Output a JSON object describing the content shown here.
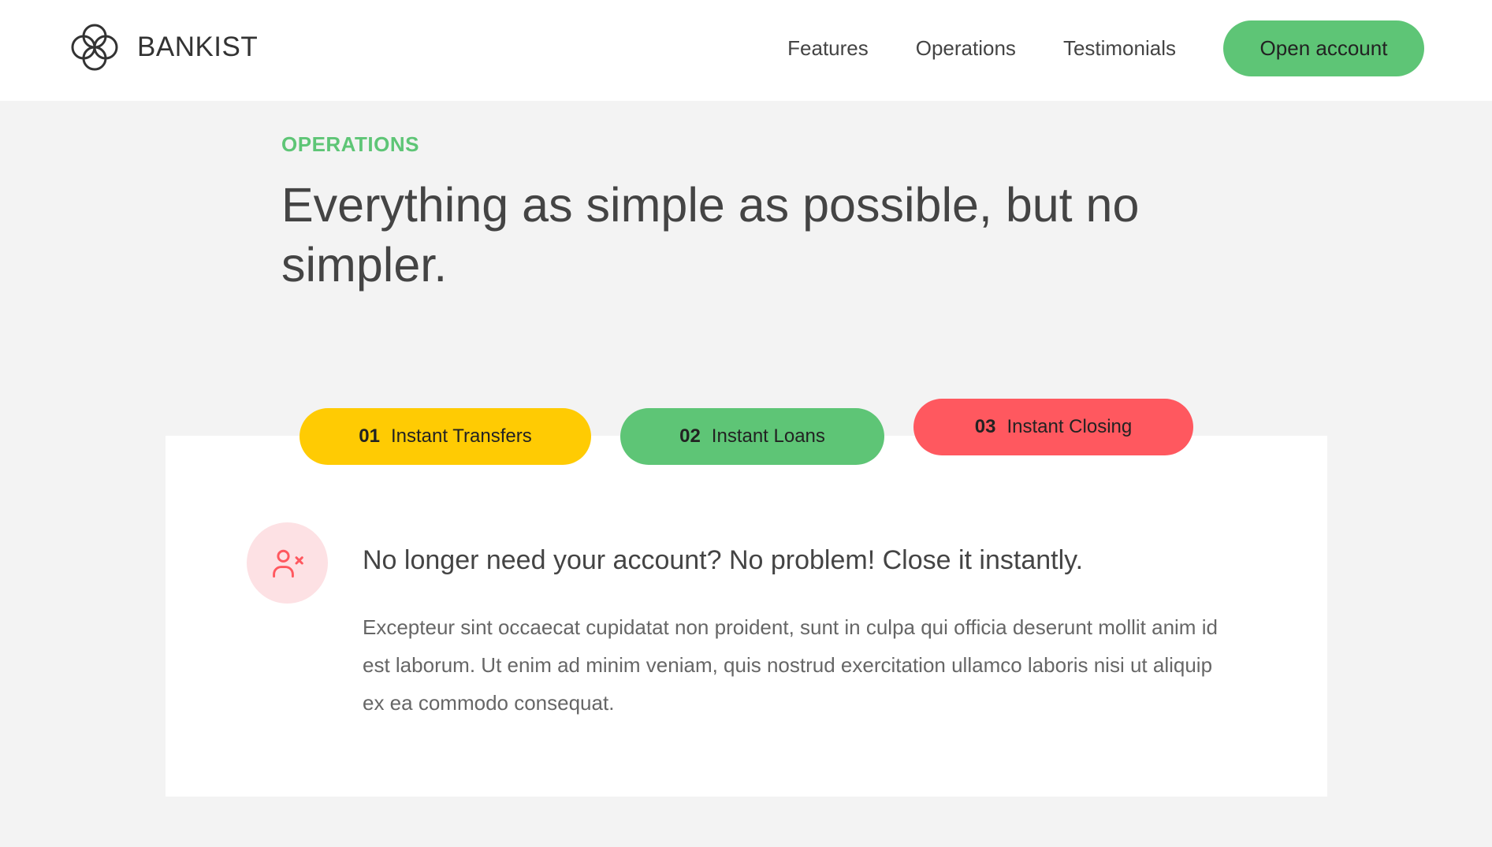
{
  "colors": {
    "green": "#5ec576",
    "yellow": "#ffcb03",
    "red": "#ff585f",
    "red_light": "#fde1e4",
    "page_bg": "#f3f3f3"
  },
  "header": {
    "brand": "BANKIST",
    "nav": [
      "Features",
      "Operations",
      "Testimonials"
    ],
    "cta_label": "Open account"
  },
  "section": {
    "label": "OPERATIONS",
    "heading": "Everything as simple as possible, but no simpler."
  },
  "tabs": [
    {
      "num": "01",
      "label": "Instant Transfers",
      "color": "yellow",
      "active": false
    },
    {
      "num": "02",
      "label": "Instant Loans",
      "color": "green",
      "active": false
    },
    {
      "num": "03",
      "label": "Instant Closing",
      "color": "red",
      "active": true
    }
  ],
  "content": {
    "icon": "user-x-icon",
    "title": "No longer need your account? No problem! Close it instantly.",
    "text": "Excepteur sint occaecat cupidatat non proident, sunt in culpa qui officia deserunt mollit anim id est laborum. Ut enim ad minim veniam, quis nostrud exercitation ullamco laboris nisi ut aliquip ex ea commodo consequat."
  }
}
